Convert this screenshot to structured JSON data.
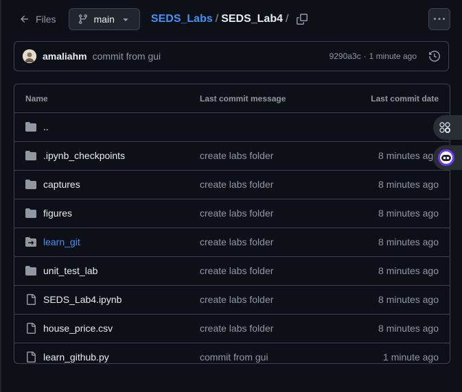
{
  "header": {
    "files_label": "Files",
    "branch": "main",
    "breadcrumb": {
      "repo": "SEDS_Labs",
      "separator": "/",
      "current": "SEDS_Lab4",
      "trailing": "/"
    }
  },
  "latest_commit": {
    "author": "amaliahm",
    "message": "commit from gui",
    "sha": "9290a3c",
    "dot": "·",
    "time": "1 minute ago"
  },
  "table": {
    "headers": {
      "name": "Name",
      "message": "Last commit message",
      "date": "Last commit date"
    },
    "rows": [
      {
        "name": "..",
        "type": "parent",
        "message": "",
        "date": ""
      },
      {
        "name": ".ipynb_checkpoints",
        "type": "folder",
        "message": "create labs folder",
        "date": "8 minutes ago"
      },
      {
        "name": "captures",
        "type": "folder",
        "message": "create labs folder",
        "date": "8 minutes ago"
      },
      {
        "name": "figures",
        "type": "folder",
        "message": "create labs folder",
        "date": "8 minutes ago"
      },
      {
        "name": "learn_git",
        "type": "submodule",
        "message": "create labs folder",
        "date": "8 minutes ago"
      },
      {
        "name": "unit_test_lab",
        "type": "folder",
        "message": "create labs folder",
        "date": "8 minutes ago"
      },
      {
        "name": "SEDS_Lab4.ipynb",
        "type": "file",
        "message": "create labs folder",
        "date": "8 minutes ago"
      },
      {
        "name": "house_price.csv",
        "type": "file",
        "message": "create labs folder",
        "date": "8 minutes ago"
      },
      {
        "name": "learn_github.py",
        "type": "file",
        "message": "commit from gui",
        "date": "1 minute ago"
      }
    ]
  },
  "colors": {
    "background": "#0d1117",
    "border": "#3d444d",
    "link": "#4493f8",
    "muted": "#9198a1",
    "text": "#e6edf3"
  }
}
